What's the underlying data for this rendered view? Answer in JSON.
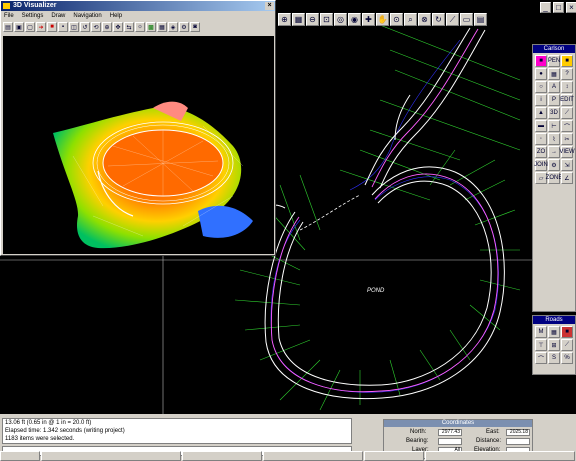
{
  "visualizer": {
    "title": "3D Visualizer",
    "close": "×",
    "menu": [
      "File",
      "Settings",
      "Draw",
      "Navigation",
      "Help"
    ]
  },
  "drawing": {
    "pond_label": "POND"
  },
  "palette": {
    "title": "Carlson",
    "buttons": [
      "PEN",
      "A",
      "EDIT",
      "3D",
      "ZO",
      "VIEW",
      "JOIN",
      "ZONE"
    ]
  },
  "roads": {
    "title": "Roads"
  },
  "status": {
    "line1": "13.06 ft (0.65 in @ 1 in = 20.0 ft)",
    "line2": "Elapsed time: 1.342 seconds (writing project)",
    "line3": "1183 items were selected."
  },
  "coordinates": {
    "title": "Coordinates",
    "north_label": "North:",
    "north_value": "2977.43",
    "east_label": "East:",
    "east_value": "2025.18",
    "bearing_label": "Bearing:",
    "distance_label": "Distance:",
    "layer_label": "Layer:",
    "layer_value": "All",
    "elevation_label": "Elevation:"
  },
  "colors": {
    "titlebar": "#0a246a",
    "chrome": "#d4d0c8",
    "road_outer": "#ffffff",
    "road_inner": "#ff60ff",
    "station_lines": "#2fd02f",
    "contour": "#3030ff"
  }
}
